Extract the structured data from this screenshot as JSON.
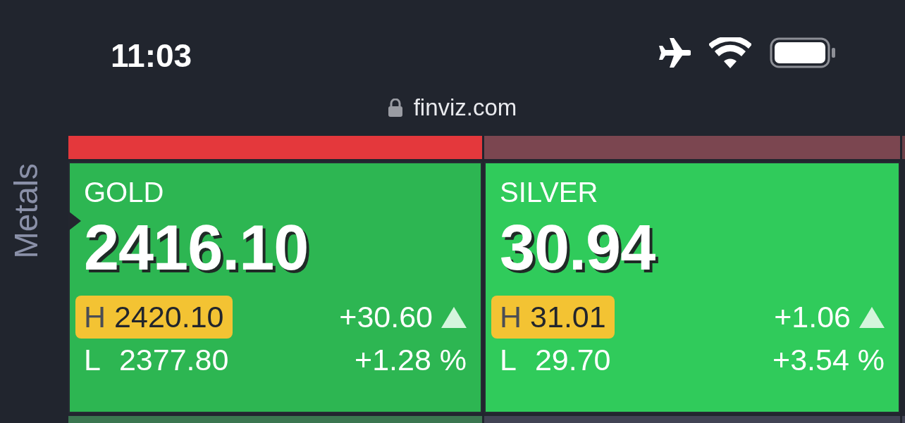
{
  "status_bar": {
    "time": "11:03"
  },
  "address_bar": {
    "url": "finviz.com"
  },
  "top_strip": [
    {
      "color": "#e4383c"
    },
    {
      "color": "#7b4650"
    },
    {
      "color": "#6e4049"
    }
  ],
  "section": {
    "label": "Metals",
    "selected": true,
    "tiles": [
      {
        "name": "GOLD",
        "price": "2416.10",
        "high_label": "H",
        "high": "2420.10",
        "low_label": "L",
        "low": "2377.80",
        "change": "+30.60",
        "change_pct": "+1.28 %",
        "rising": true,
        "color": "#2db652"
      },
      {
        "name": "SILVER",
        "price": "30.94",
        "high_label": "H",
        "high": "31.01",
        "low_label": "L",
        "low": "29.70",
        "change": "+1.06",
        "change_pct": "+3.54 %",
        "rising": true,
        "color": "#30cb5b"
      }
    ]
  },
  "bottom_strip": [
    {
      "color": "#3b7650"
    },
    {
      "color": "#414354"
    },
    {
      "color": "#414354"
    }
  ]
}
